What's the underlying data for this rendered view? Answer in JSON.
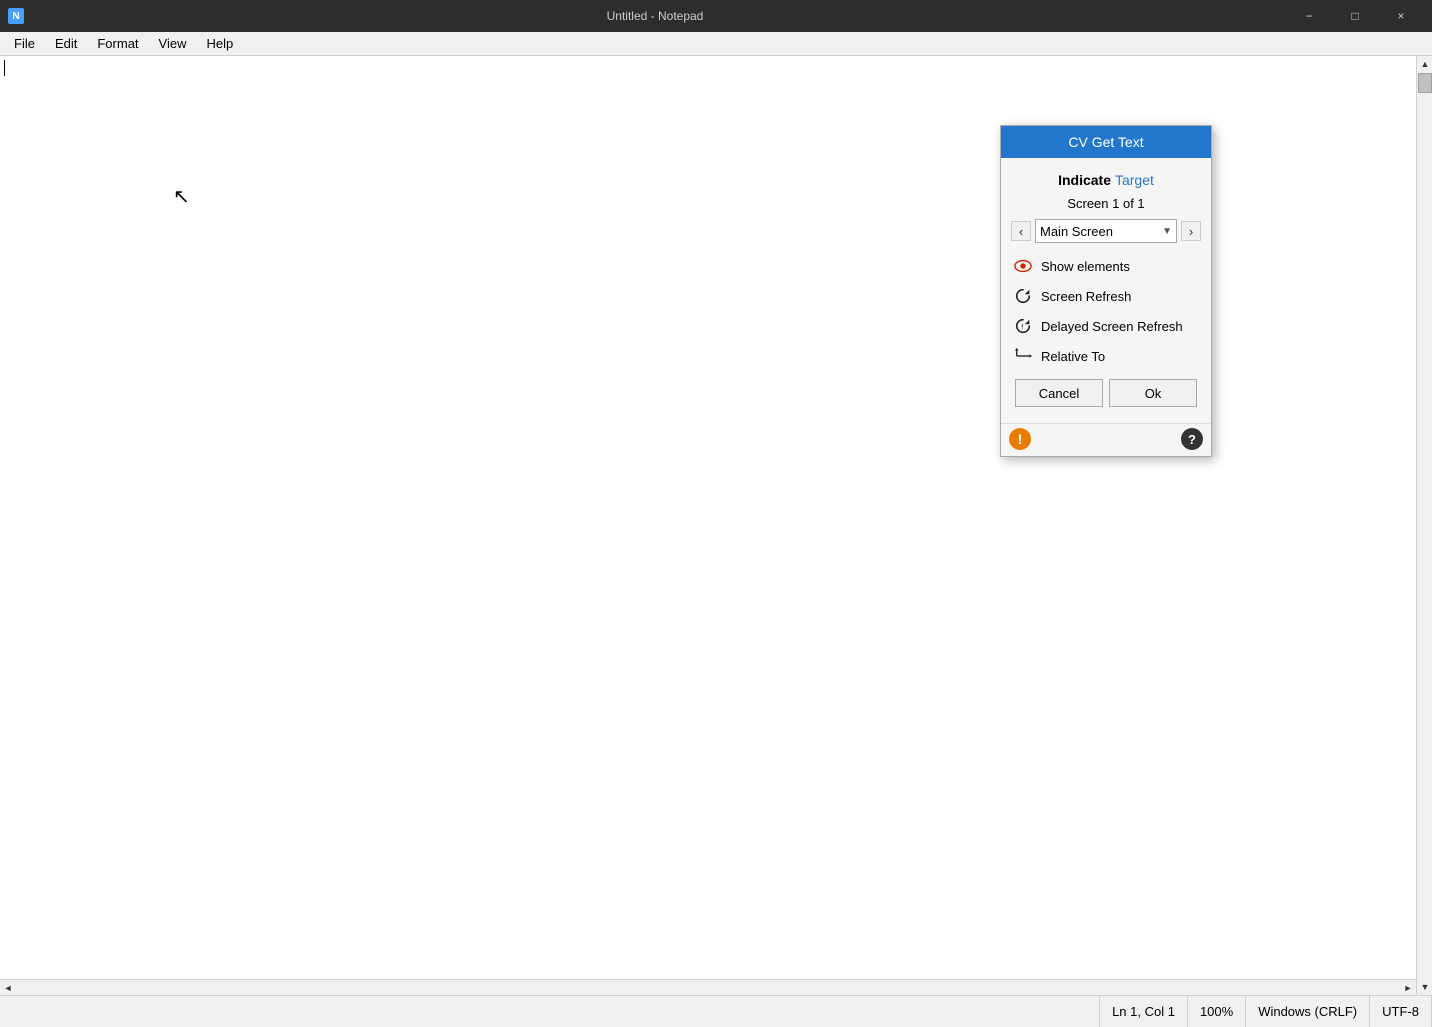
{
  "titleBar": {
    "icon": "N",
    "title": "Untitled - Notepad",
    "minimize": "−",
    "maximize": "□",
    "close": "×"
  },
  "menuBar": {
    "items": [
      "File",
      "Edit",
      "Format",
      "View",
      "Help"
    ]
  },
  "editor": {
    "content": ""
  },
  "statusBar": {
    "position": "Ln 1, Col 1",
    "zoom": "100%",
    "lineEnding": "Windows (CRLF)",
    "encoding": "UTF-8"
  },
  "dialog": {
    "title": "CV Get Text",
    "indicateLabel": "Indicate",
    "targetLabel": "Target",
    "screenInfo": "Screen 1 of 1",
    "screenName": "Main Screen",
    "navPrev": "‹",
    "navNext": "›",
    "dropdownArrow": "▼",
    "options": [
      {
        "id": "show-elements",
        "label": "Show elements",
        "icon": "eye"
      },
      {
        "id": "screen-refresh",
        "label": "Screen Refresh",
        "icon": "refresh"
      },
      {
        "id": "delayed-screen-refresh",
        "label": "Delayed Screen Refresh",
        "icon": "delayed-refresh"
      },
      {
        "id": "relative-to",
        "label": "Relative To",
        "icon": "relative"
      }
    ],
    "cancelButton": "Cancel",
    "okButton": "Ok",
    "warningIcon": "!",
    "helpIcon": "?"
  }
}
